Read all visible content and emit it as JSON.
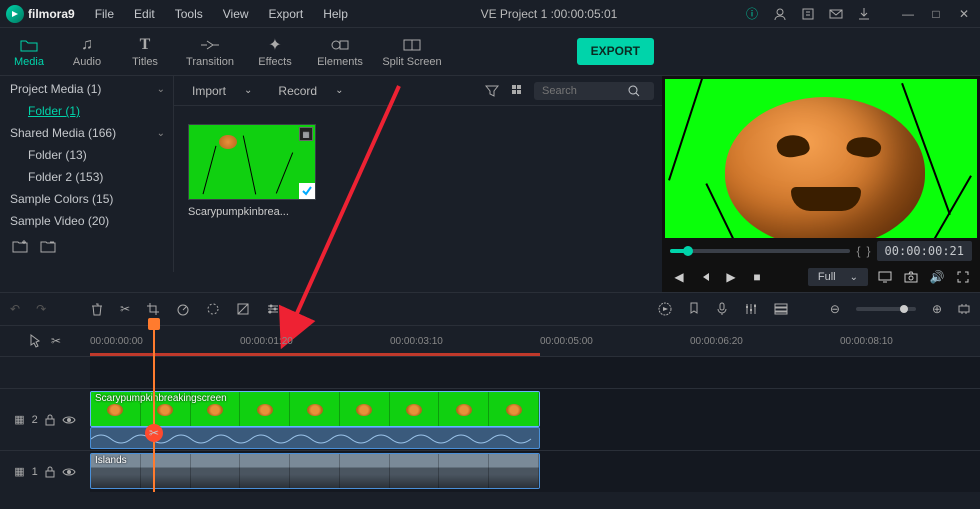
{
  "app": {
    "brand": "filmora9",
    "title": "VE Project 1 :00:00:05:01"
  },
  "menubar": [
    "File",
    "Edit",
    "Tools",
    "View",
    "Export",
    "Help"
  ],
  "tabs": [
    {
      "label": "Media",
      "icon": "folder-icon",
      "active": true
    },
    {
      "label": "Audio",
      "icon": "music-icon"
    },
    {
      "label": "Titles",
      "icon": "text-icon"
    },
    {
      "label": "Transition",
      "icon": "transition-icon"
    },
    {
      "label": "Effects",
      "icon": "sparkle-icon"
    },
    {
      "label": "Elements",
      "icon": "shapes-icon"
    },
    {
      "label": "Split Screen",
      "icon": "splitscreen-icon"
    }
  ],
  "export_label": "EXPORT",
  "sidebar": {
    "items": [
      {
        "label": "Project Media (1)",
        "chevron": true,
        "indent": 0
      },
      {
        "label": "Folder (1)",
        "indent": 1,
        "active": true
      },
      {
        "label": "Shared Media (166)",
        "chevron": true,
        "indent": 0
      },
      {
        "label": "Folder (13)",
        "indent": 1
      },
      {
        "label": "Folder 2 (153)",
        "indent": 1
      },
      {
        "label": "Sample Colors (15)",
        "indent": 0
      },
      {
        "label": "Sample Video (20)",
        "indent": 0
      }
    ]
  },
  "content_bar": {
    "import": "Import",
    "record": "Record",
    "search_placeholder": "Search"
  },
  "thumbnail": {
    "label": "Scarypumpkinbrea..."
  },
  "preview": {
    "time_braces_l": "{",
    "time_braces_r": "}",
    "timecode": "00:00:00:21",
    "quality": "Full"
  },
  "timeline": {
    "ruler": [
      "00:00:00:00",
      "00:00:01:20",
      "00:00:03:10",
      "00:00:05:00",
      "00:00:06:20",
      "00:00:08:10"
    ],
    "tracks": [
      {
        "name": "2",
        "clip_label": "Scarypumpkinbreakingscreen"
      },
      {
        "name": "1",
        "clip_label": "Islands"
      }
    ]
  }
}
